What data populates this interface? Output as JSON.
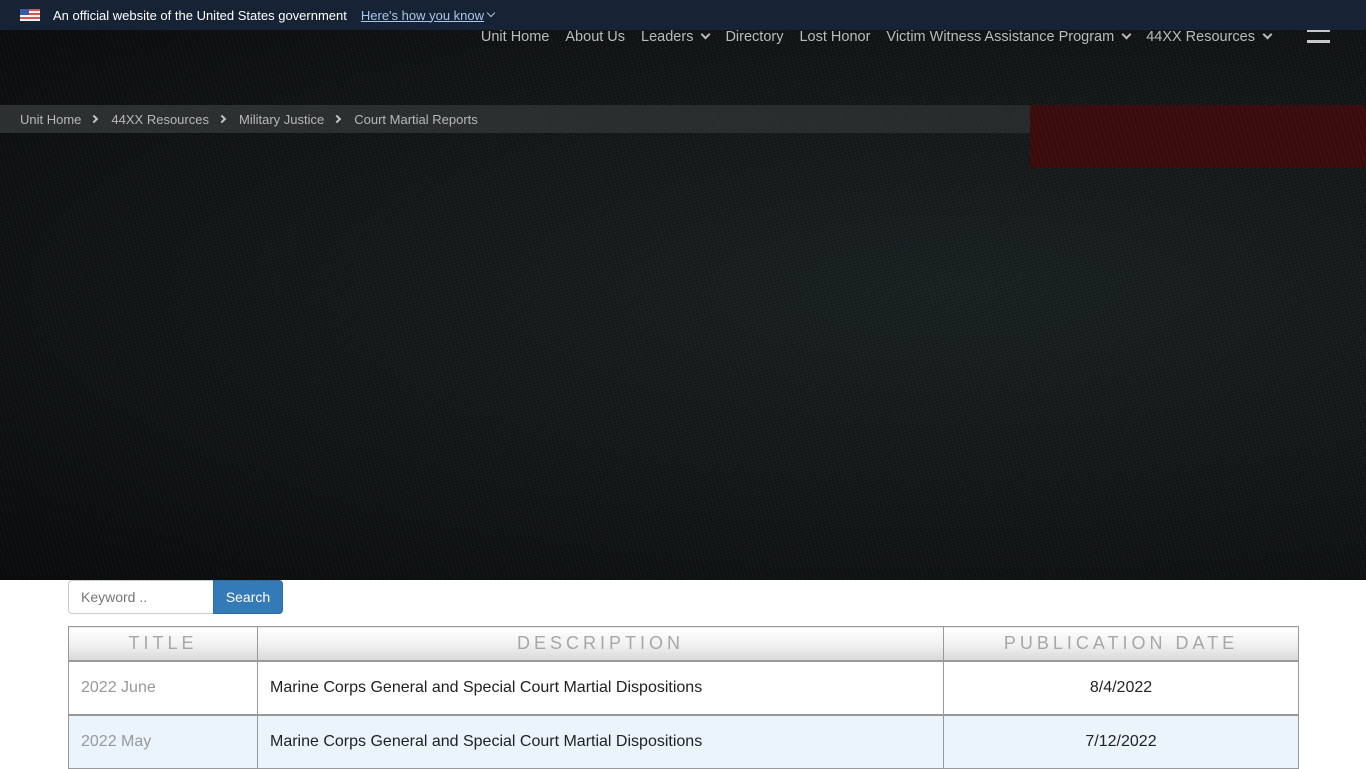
{
  "gov_banner": {
    "flag_icon": "us-flag-icon",
    "text": "An official website of the United States government",
    "link_label": "Here's how you know"
  },
  "nav": {
    "items": [
      {
        "label": "Unit Home",
        "has_dropdown": false
      },
      {
        "label": "About Us",
        "has_dropdown": false
      },
      {
        "label": "Leaders",
        "has_dropdown": true
      },
      {
        "label": "Directory",
        "has_dropdown": false
      },
      {
        "label": "Lost Honor",
        "has_dropdown": false
      },
      {
        "label": "Victim Witness Assistance Program",
        "has_dropdown": true
      },
      {
        "label": "44XX Resources",
        "has_dropdown": true
      }
    ],
    "menu_icon": "hamburger-icon"
  },
  "breadcrumb": [
    {
      "label": "Unit Home"
    },
    {
      "label": "44XX Resources"
    },
    {
      "label": "Military Justice"
    },
    {
      "label": "Court Martial Reports"
    }
  ],
  "search": {
    "placeholder": "Keyword ..",
    "value": "",
    "button_label": "Search"
  },
  "table": {
    "headers": [
      "TITLE",
      "DESCRIPTION",
      "PUBLICATION DATE"
    ],
    "rows": [
      {
        "title": "2022 June",
        "description": "Marine Corps General and Special Court Martial Dispositions",
        "date": "8/4/2022"
      },
      {
        "title": "2022 May",
        "description": "Marine Corps General and Special Court Martial Dispositions",
        "date": "7/12/2022"
      }
    ]
  },
  "colors": {
    "banner_bg": "#162335",
    "accent_blue": "#337ab7",
    "hero_red": "#3a0b0c",
    "row_alt": "#ebf4fc"
  }
}
